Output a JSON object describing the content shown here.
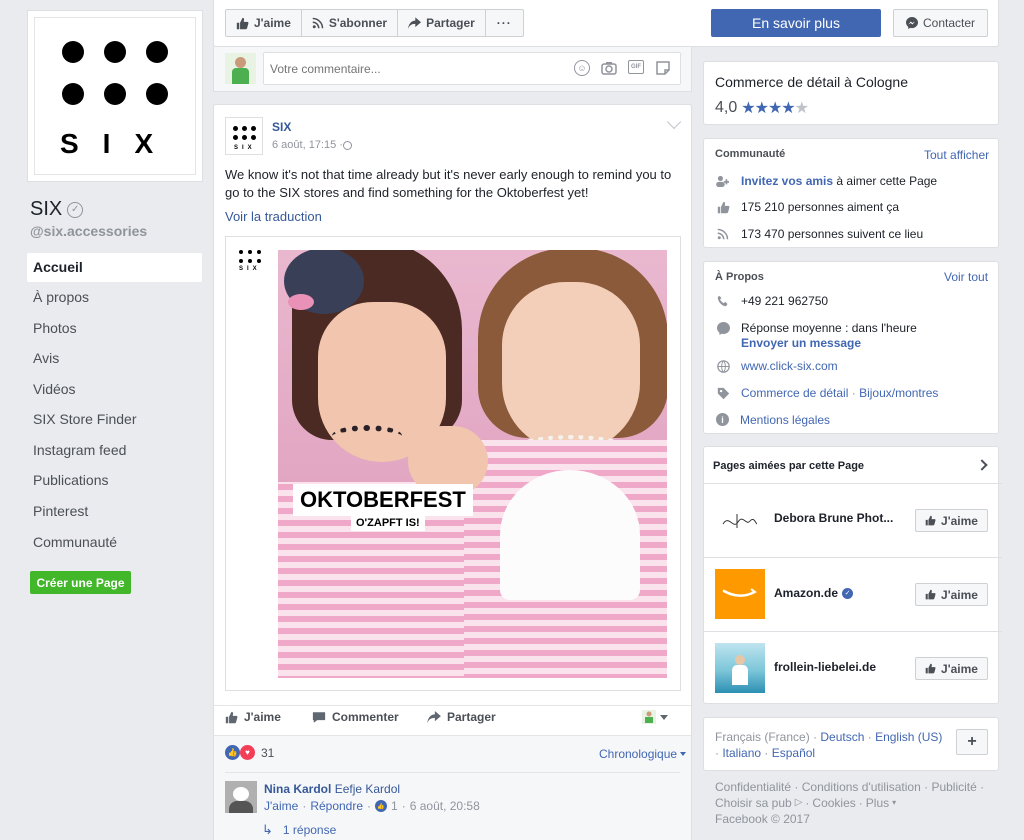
{
  "page": {
    "name": "SIX",
    "username": "@six.accessories",
    "logo_text": "SIX"
  },
  "nav": {
    "items": [
      "Accueil",
      "À propos",
      "Photos",
      "Avis",
      "Vidéos",
      "SIX Store Finder",
      "Instagram feed",
      "Publications",
      "Pinterest",
      "Communauté"
    ],
    "create_page": "Créer une Page"
  },
  "actions": {
    "like": "J'aime",
    "subscribe": "S'abonner",
    "share": "Partager",
    "more": "···",
    "learn_more": "En savoir plus",
    "contact": "Contacter"
  },
  "comment_box": {
    "placeholder": "Votre commentaire..."
  },
  "post": {
    "author": "SIX",
    "date": "6 août, 17:15 · ",
    "text": "We know it's not that time already but it's never early enough to remind you to go to the SIX stores and find something for the Oktoberfest yet!",
    "translate": "Voir la traduction",
    "image_title": "OKTOBERFEST",
    "image_subtitle": "O'ZAPFT IS!",
    "image_logo": "SIX",
    "like": "J'aime",
    "comment": "Commenter",
    "share": "Partager",
    "reaction_count": "31",
    "sort": "Chronologique",
    "comment_author": "Nina Kardol",
    "comment_tag": "Eefje Kardol",
    "comment_like": "J'aime",
    "comment_reply": "Répondre",
    "comment_likes": "1",
    "comment_date": "6 août, 20:58",
    "replies": "1 réponse"
  },
  "rating": {
    "category": "Commerce de détail à Cologne",
    "score": "4,0",
    "stars": 4,
    "max_stars": 5
  },
  "community": {
    "title": "Communauté",
    "see_all": "Tout afficher",
    "invite_link": "Invitez vos amis",
    "invite_rest": " à aimer cette Page",
    "likes": "175 210 personnes aiment ça",
    "follows": "173 470 personnes suivent ce lieu"
  },
  "about": {
    "title": "À Propos",
    "see_all": "Voir tout",
    "phone": "+49 221 962750",
    "response": "Réponse moyenne : dans l'heure",
    "message": "Envoyer un message",
    "website": "www.click-six.com",
    "category1": "Commerce de détail",
    "category_sep": " · ",
    "category2": "Bijoux/montres",
    "legal": "Mentions légales"
  },
  "liked_pages": {
    "title": "Pages aimées par cette Page",
    "like": "J'aime",
    "items": [
      {
        "name": "Debora Brune Phot..."
      },
      {
        "name": "Amazon.de"
      },
      {
        "name": "frollein-liebelei.de"
      }
    ]
  },
  "languages": {
    "current": "Français (France)",
    "sep": " · ",
    "others": [
      "Deutsch",
      "English (US)",
      "Italiano",
      "Español"
    ],
    "add": "+"
  },
  "footer": {
    "links1": [
      "Confidentialité",
      "Conditions d'utilisation",
      "Publicité"
    ],
    "adchoices": "Choisir sa pub",
    "links2": [
      "Cookies",
      "Plus"
    ],
    "copyright": "Facebook © 2017"
  },
  "colors": {
    "accent": "#4267b2",
    "green_button": "#42b72a",
    "amazon": "#ff9900"
  }
}
